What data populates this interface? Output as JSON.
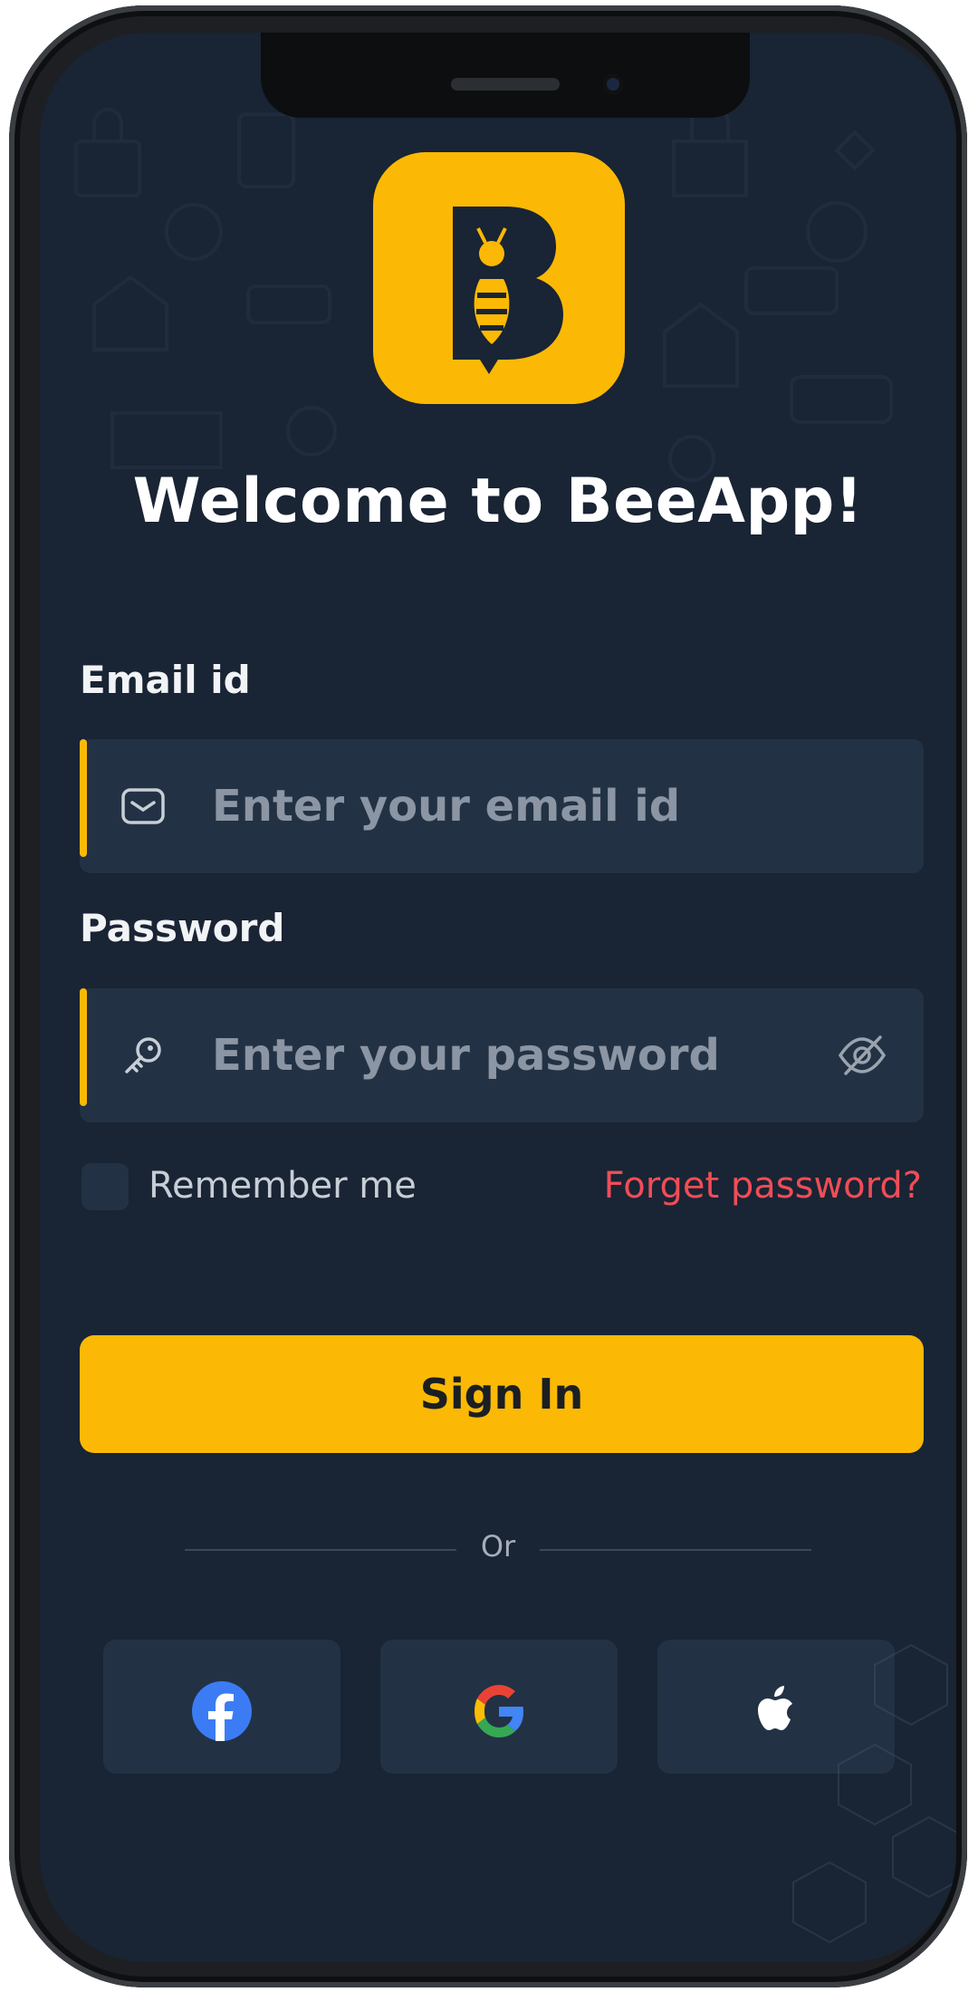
{
  "app": {
    "welcome_title": "Welcome to BeeApp!",
    "brand_color": "#fbb905",
    "background_color": "#192434"
  },
  "email": {
    "label": "Email id",
    "placeholder": "Enter your email id",
    "icon": "mail-icon"
  },
  "password": {
    "label": "Password",
    "placeholder": "Enter your password",
    "icon": "key-icon",
    "toggle_icon": "eye-off-icon"
  },
  "remember": {
    "label": "Remember me",
    "checked": false
  },
  "forgot": {
    "label": "Forget password?",
    "color": "#ef4d57"
  },
  "signin": {
    "label": "Sign In"
  },
  "divider": {
    "label": "Or"
  },
  "social": [
    {
      "name": "facebook",
      "icon": "facebook-icon"
    },
    {
      "name": "google",
      "icon": "google-icon"
    },
    {
      "name": "apple",
      "icon": "apple-icon"
    }
  ]
}
